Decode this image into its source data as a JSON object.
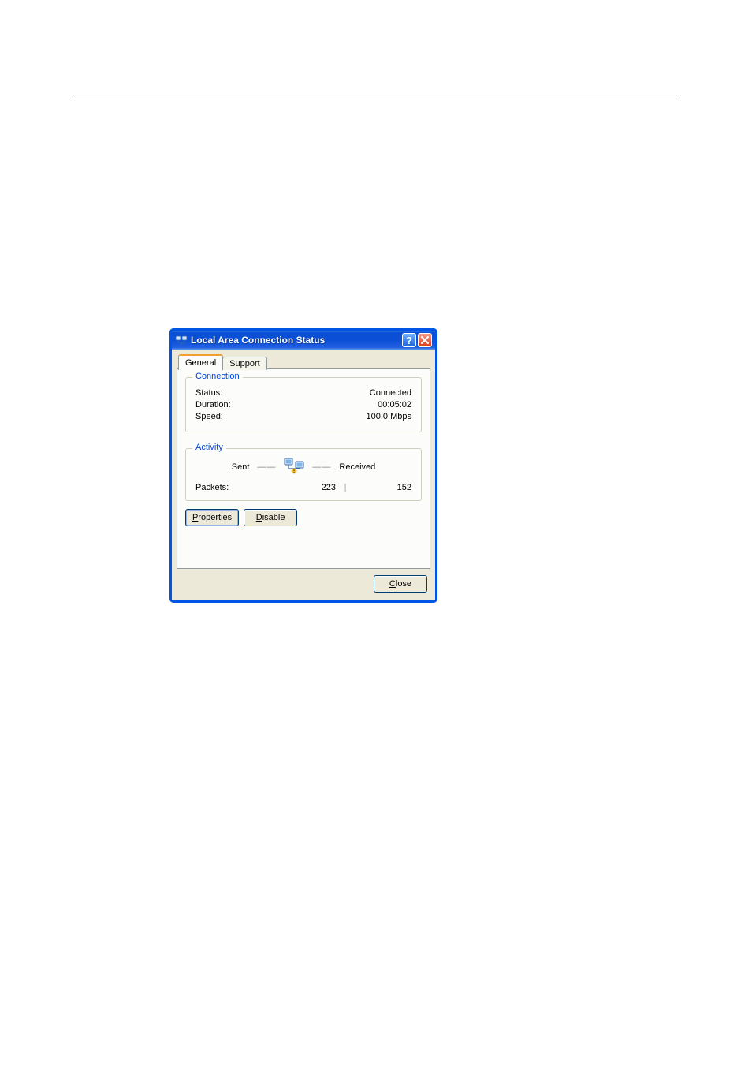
{
  "dialog": {
    "title": "Local Area Connection Status",
    "tabs": [
      {
        "label": "General",
        "active": true
      },
      {
        "label": "Support",
        "active": false
      }
    ],
    "connection": {
      "legend": "Connection",
      "status_label": "Status:",
      "status_value": "Connected",
      "duration_label": "Duration:",
      "duration_value": "00:05:02",
      "speed_label": "Speed:",
      "speed_value": "100.0 Mbps"
    },
    "activity": {
      "legend": "Activity",
      "sent_label": "Sent",
      "received_label": "Received",
      "packets_label": "Packets:",
      "packets_sent": "223",
      "packets_received": "152"
    },
    "buttons": {
      "properties": "Properties",
      "disable": "Disable",
      "close": "Close"
    }
  }
}
